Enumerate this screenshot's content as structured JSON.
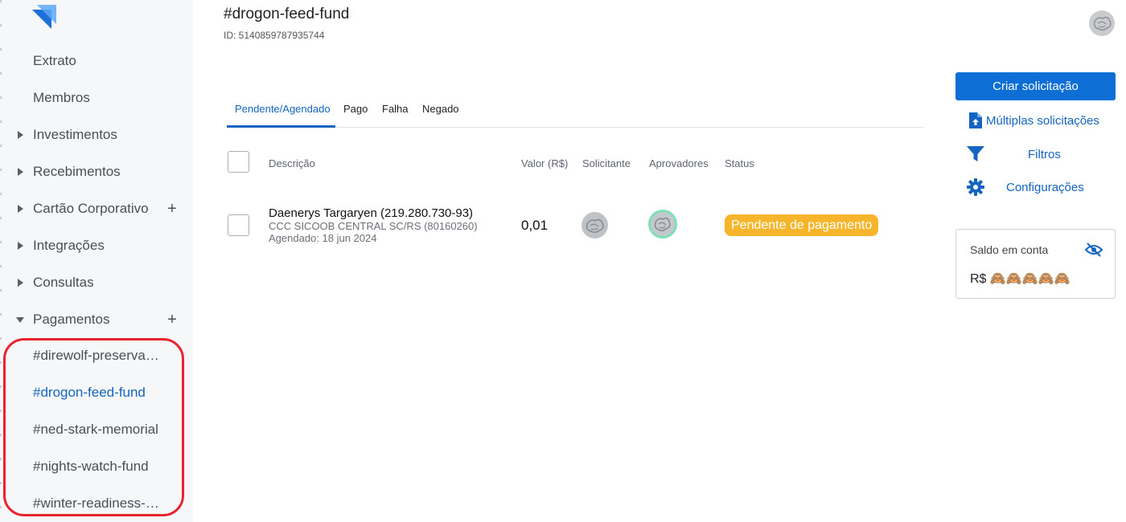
{
  "sidebar": {
    "items": [
      {
        "label": "Extrato"
      },
      {
        "label": "Membros"
      },
      {
        "label": "Investimentos"
      },
      {
        "label": "Recebimentos"
      },
      {
        "label": "Cartão Corporativo"
      },
      {
        "label": "Integrações"
      },
      {
        "label": "Consultas"
      },
      {
        "label": "Pagamentos"
      }
    ],
    "payment_groups": [
      {
        "label": "#direwolf-preservation"
      },
      {
        "label": "#drogon-feed-fund"
      },
      {
        "label": "#ned-stark-memorial"
      },
      {
        "label": "#nights-watch-fund"
      },
      {
        "label": "#winter-readiness-fund"
      }
    ],
    "plus_symbol": "+"
  },
  "header": {
    "title": "#drogon-feed-fund",
    "id_text": "ID: 5140859787935744"
  },
  "tabs": [
    {
      "label": "Pendente/Agendado"
    },
    {
      "label": "Pago"
    },
    {
      "label": "Falha"
    },
    {
      "label": "Negado"
    }
  ],
  "table": {
    "headers": {
      "description": "Descrição",
      "value": "Valor (R$)",
      "requester": "Solicitante",
      "approvers": "Aprovadores",
      "status": "Status"
    },
    "rows": [
      {
        "name": "Daenerys Targaryen (219.280.730-93)",
        "bank": "CCC SICOOB CENTRAL SC/RS (80160260)",
        "scheduled": "Agendado: 18 jun 2024",
        "value": "0,01",
        "status": "Pendente de pagamento"
      }
    ]
  },
  "actions": {
    "create_request": "Criar solicitação",
    "multiple_requests": "Múltiplas solicitações",
    "filters": "Filtros",
    "settings": "Configurações"
  },
  "balance": {
    "title": "Saldo em conta",
    "value": "R$ 🙈🙈🙈🙈🙈"
  },
  "colors": {
    "accent": "#1565c0",
    "primary_button": "#0d6fd6",
    "pending_badge": "#f7b52b",
    "highlight_ring": "#e8232d",
    "approver_ring": "#7ee0b3"
  }
}
